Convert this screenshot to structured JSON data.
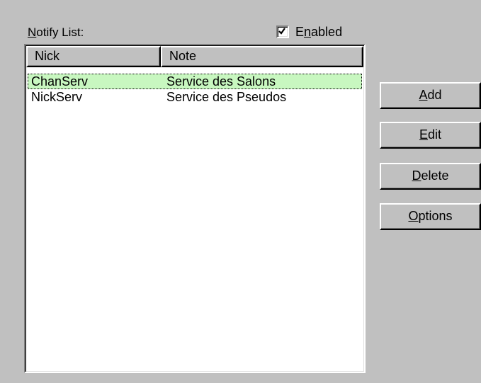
{
  "notify": {
    "label_underlined": "N",
    "label_rest": "otify List:"
  },
  "enabled": {
    "checked": true,
    "label_pre": "E",
    "label_underlined": "n",
    "label_post": "abled"
  },
  "list": {
    "columns": [
      "Nick",
      "Note"
    ],
    "rows": [
      {
        "nick": "ChanServ",
        "note": "Service des Salons",
        "selected": true
      },
      {
        "nick": "NickServ",
        "note": "Service des Pseudos",
        "selected": false
      }
    ]
  },
  "buttons": {
    "add": {
      "underlined": "A",
      "rest": "dd"
    },
    "edit": {
      "underlined": "E",
      "rest": "dit"
    },
    "delete": {
      "underlined": "D",
      "rest": "elete"
    },
    "options": {
      "underlined": "O",
      "rest": "ptions"
    }
  },
  "colors": {
    "dialog_bg": "#c0c0c0",
    "selection_bg": "#c8f7c0",
    "list_bg": "#ffffff"
  }
}
